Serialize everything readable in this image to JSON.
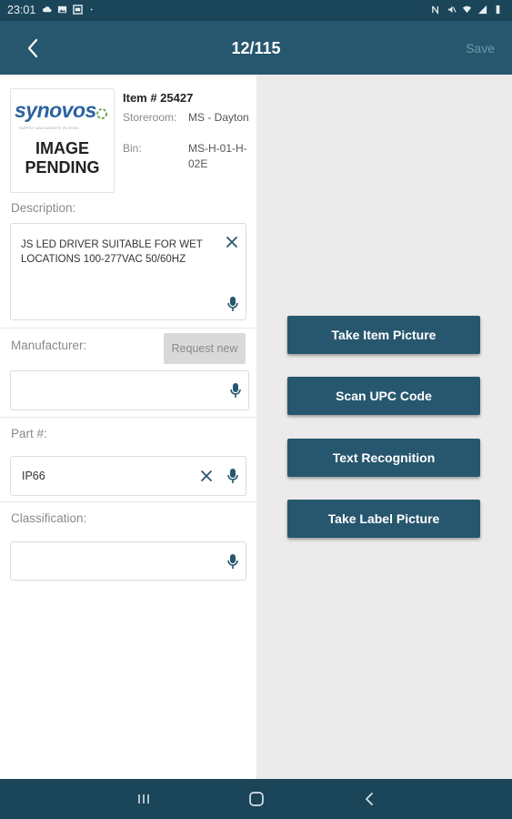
{
  "status_bar": {
    "time": "23:01",
    "left_icons": [
      "cloud-icon",
      "image-icon",
      "gallery-icon",
      "dot-icon"
    ],
    "right_icons": [
      "nfc-icon",
      "mute-icon",
      "wifi-icon",
      "signal-icon",
      "battery-icon"
    ]
  },
  "header": {
    "back_icon": "chevron-left-icon",
    "title": "12/115",
    "save_label": "Save"
  },
  "item": {
    "image_placeholder": {
      "logo_text": "synovos",
      "logo_tagline": "SUPPLY AND ASSETS IN SYNC",
      "pending_text": "IMAGE\nPENDING"
    },
    "item_number": "Item # 25427",
    "storeroom_label": "Storeroom:",
    "storeroom_value": "MS - Dayton",
    "bin_label": "Bin:",
    "bin_value": "MS-H-01-H-02E"
  },
  "form": {
    "description": {
      "label": "Description:",
      "value": "JS LED DRIVER SUITABLE FOR WET LOCATIONS 100-277VAC 50/60HZ"
    },
    "manufacturer": {
      "label": "Manufacturer:",
      "request_new_label": "Request new",
      "value": ""
    },
    "part_number": {
      "label": "Part #:",
      "value": "IP66"
    },
    "classification": {
      "label": "Classification:",
      "value": ""
    }
  },
  "actions": {
    "take_item_picture": "Take Item Picture",
    "scan_upc_code": "Scan UPC Code",
    "text_recognition": "Text Recognition",
    "take_label_picture": "Take Label Picture"
  },
  "nav_bar": {
    "recents_icon": "recents-icon",
    "home_icon": "home-icon",
    "back_icon": "back-icon"
  },
  "colors": {
    "header_bg": "#27576e",
    "status_bg": "#1b4558",
    "button_bg": "#27576e",
    "panel_bg": "#ebebeb",
    "save_disabled": "#6f97a9"
  }
}
